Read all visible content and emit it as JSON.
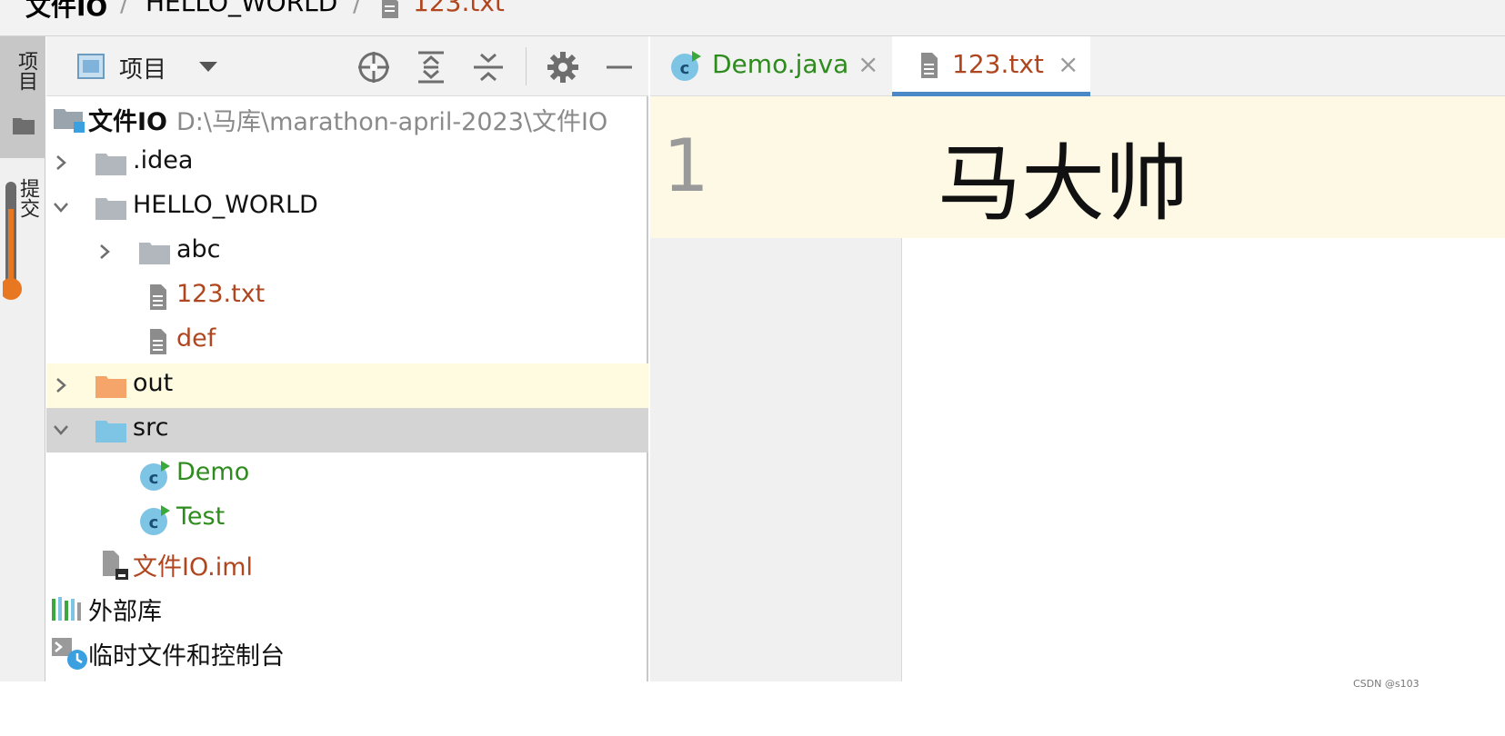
{
  "breadcrumb": {
    "items": [
      "文件IO",
      "HELLO_WORLD",
      "123.txt"
    ],
    "separator": "/"
  },
  "toolstrip": {
    "project_tab": "项目",
    "commit_tab": "提交"
  },
  "project_panel": {
    "title": "项目",
    "toolbar_icons": [
      "locate-icon",
      "expand-all-icon",
      "collapse-all-icon",
      "gear-icon",
      "minimize-icon"
    ],
    "tree": [
      {
        "label": "文件IO",
        "path": "D:\\马库\\marathon-april-2023\\文件IO",
        "kind": "module",
        "expanded": true
      },
      {
        "label": ".idea",
        "kind": "folder",
        "expanded": false
      },
      {
        "label": "HELLO_WORLD",
        "kind": "folder",
        "expanded": true
      },
      {
        "label": "abc",
        "kind": "folder",
        "expanded": false
      },
      {
        "label": "123.txt",
        "kind": "text-file"
      },
      {
        "label": "def",
        "kind": "text-file"
      },
      {
        "label": "out",
        "kind": "folder-excluded",
        "expanded": false
      },
      {
        "label": "src",
        "kind": "folder-source",
        "expanded": true,
        "selected": true
      },
      {
        "label": "Demo",
        "kind": "java-class"
      },
      {
        "label": "Test",
        "kind": "java-class"
      },
      {
        "label": "文件IO.iml",
        "kind": "iml-file"
      },
      {
        "label": "外部库",
        "kind": "library"
      },
      {
        "label": "临时文件和控制台",
        "kind": "scratches"
      }
    ]
  },
  "editor": {
    "tabs": [
      {
        "label": "Demo.java",
        "active": false,
        "close": "×"
      },
      {
        "label": "123.txt",
        "active": true,
        "close": "×"
      }
    ],
    "lines": [
      {
        "number": "1",
        "text": "马大帅"
      }
    ]
  },
  "colors": {
    "accent": "#4a88c7",
    "java_green": "#2e8b1e",
    "file_brown": "#b0461f",
    "current_line": "#fdf9e5",
    "excluded_folder": "#f5a46a",
    "source_folder": "#7ec4e4"
  },
  "watermark": "CSDN @s103"
}
